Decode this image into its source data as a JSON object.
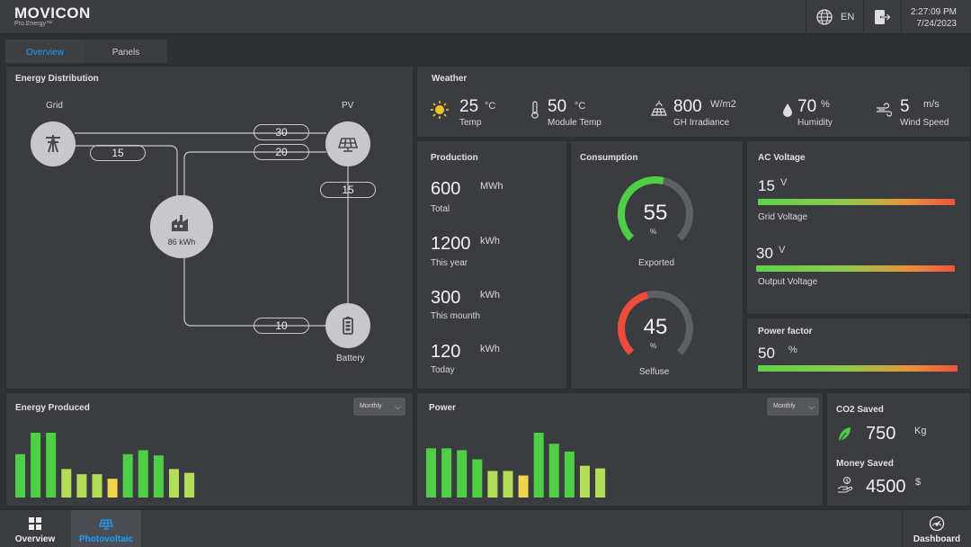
{
  "header": {
    "logo": "MOVICON",
    "logo_sub": "Pro.Energy™",
    "language": "EN",
    "time": "2:27:09 PM",
    "date": "7/24/2023",
    "icons": [
      "globe-icon",
      "logout-icon"
    ]
  },
  "tabs": [
    {
      "label": "Overview",
      "active": true
    },
    {
      "label": "Panels",
      "active": false
    }
  ],
  "energy_distribution": {
    "title": "Energy Distribution",
    "grid_label": "Grid",
    "pv_label": "PV",
    "battery_label": "Battery",
    "home_value": "86 kWh",
    "flow_grid_home": "15",
    "flow_grid_pv": "30",
    "flow_home_pv": "20",
    "flow_pv_battery": "15",
    "flow_home_battery": "10"
  },
  "weather": {
    "title": "Weather",
    "items": [
      {
        "icon": "sun-icon",
        "value": "25",
        "unit": "°C",
        "label": "Temp"
      },
      {
        "icon": "thermometer-icon",
        "value": "50",
        "unit": "°C",
        "label": "Module Temp"
      },
      {
        "icon": "solar-irradiance-icon",
        "value": "800",
        "unit": "W/m2",
        "label": "GH Irradiance"
      },
      {
        "icon": "droplet-icon",
        "value": "70",
        "unit": "%",
        "label": "Humidity"
      },
      {
        "icon": "wind-icon",
        "value": "5",
        "unit": "m/s",
        "label": "Wind Speed"
      }
    ]
  },
  "production": {
    "title": "Production",
    "rows": [
      {
        "value": "600",
        "unit": "MWh",
        "label": "Total"
      },
      {
        "value": "1200",
        "unit": "kWh",
        "label": "This year"
      },
      {
        "value": "300",
        "unit": "kWh",
        "label": "This mounth"
      },
      {
        "value": "120",
        "unit": "kWh",
        "label": "Today"
      }
    ]
  },
  "consumption": {
    "title": "Consumption",
    "gauges": [
      {
        "value": "55",
        "unit": "%",
        "label": "Exported",
        "fraction": 0.55,
        "color": "#4fcf45"
      },
      {
        "value": "45",
        "unit": "%",
        "label": "Selfuse",
        "fraction": 0.45,
        "color": "#ef4b3c"
      }
    ]
  },
  "ac_voltage": {
    "title": "AC Voltage",
    "rows": [
      {
        "value": "15",
        "unit": "V",
        "label": "Grid Voltage"
      },
      {
        "value": "30",
        "unit": "V",
        "label": "Output Voltage"
      }
    ]
  },
  "power_factor": {
    "title": "Power factor",
    "value": "50",
    "unit": "%"
  },
  "energy_produced": {
    "title": "Energy Produced",
    "dropdown": "Monthly",
    "bars": [
      {
        "value": 0.67,
        "color": "#4fcf45"
      },
      {
        "value": 1.0,
        "color": "#4fcf45"
      },
      {
        "value": 1.0,
        "color": "#4fcf45"
      },
      {
        "value": 0.44,
        "color": "#b5dd5a"
      },
      {
        "value": 0.36,
        "color": "#b5dd5a"
      },
      {
        "value": 0.36,
        "color": "#b5dd5a"
      },
      {
        "value": 0.29,
        "color": "#f2d34c"
      },
      {
        "value": 0.67,
        "color": "#4fcf45"
      },
      {
        "value": 0.73,
        "color": "#4fcf45"
      },
      {
        "value": 0.65,
        "color": "#4fcf45"
      },
      {
        "value": 0.44,
        "color": "#b5dd5a"
      },
      {
        "value": 0.38,
        "color": "#b5dd5a"
      }
    ]
  },
  "power": {
    "title": "Power",
    "dropdown": "Monthly",
    "bars": [
      {
        "value": 0.76,
        "color": "#4fcf45"
      },
      {
        "value": 0.76,
        "color": "#4fcf45"
      },
      {
        "value": 0.73,
        "color": "#4fcf45"
      },
      {
        "value": 0.59,
        "color": "#4fcf45"
      },
      {
        "value": 0.41,
        "color": "#b5dd5a"
      },
      {
        "value": 0.41,
        "color": "#b5dd5a"
      },
      {
        "value": 0.34,
        "color": "#f2d34c"
      },
      {
        "value": 1.0,
        "color": "#4fcf45"
      },
      {
        "value": 0.83,
        "color": "#4fcf45"
      },
      {
        "value": 0.71,
        "color": "#4fcf45"
      },
      {
        "value": 0.49,
        "color": "#b5dd5a"
      },
      {
        "value": 0.45,
        "color": "#b5dd5a"
      }
    ]
  },
  "co2": {
    "title": "CO2 Saved",
    "value": "750",
    "unit": "Kg",
    "money_title": "Money Saved",
    "money_value": "4500",
    "money_unit": "$"
  },
  "bottom_nav": [
    {
      "label": "Overview",
      "icon": "grid-icon",
      "active": false
    },
    {
      "label": "Photovoltaic",
      "icon": "solar-panel-icon",
      "active": true
    },
    {
      "label": "Dashboard",
      "icon": "gauge-icon",
      "active": false
    }
  ]
}
